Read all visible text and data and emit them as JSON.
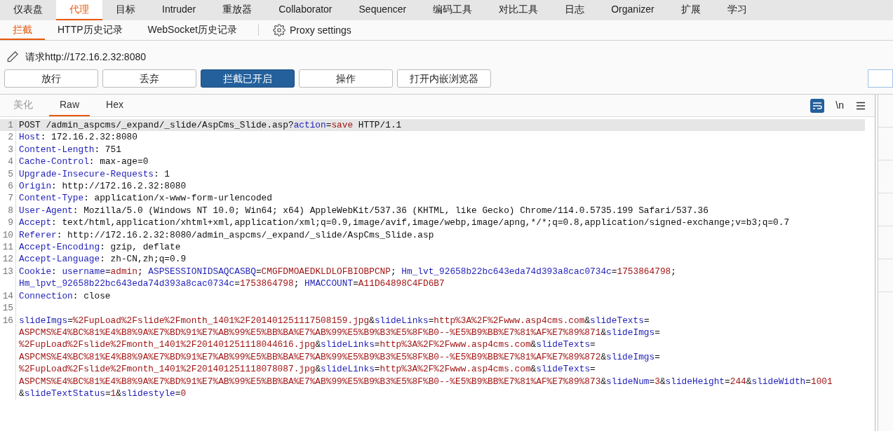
{
  "main_tabs": [
    {
      "label": "仪表盘",
      "selected": false
    },
    {
      "label": "代理",
      "selected": true
    },
    {
      "label": "目标",
      "selected": false
    },
    {
      "label": "Intruder",
      "selected": false
    },
    {
      "label": "重放器",
      "selected": false
    },
    {
      "label": "Collaborator",
      "selected": false
    },
    {
      "label": "Sequencer",
      "selected": false
    },
    {
      "label": "编码工具",
      "selected": false
    },
    {
      "label": "对比工具",
      "selected": false
    },
    {
      "label": "日志",
      "selected": false
    },
    {
      "label": "Organizer",
      "selected": false
    },
    {
      "label": "扩展",
      "selected": false
    },
    {
      "label": "学习",
      "selected": false
    }
  ],
  "sub_tabs": [
    {
      "label": "拦截",
      "selected": true
    },
    {
      "label": "HTTP历史记录",
      "selected": false
    },
    {
      "label": "WebSocket历史记录",
      "selected": false
    }
  ],
  "settings_link": "Proxy settings",
  "request_target": "请求http://172.16.2.32:8080",
  "buttons": [
    {
      "label": "放行",
      "pressed": false
    },
    {
      "label": "丢弃",
      "pressed": false
    },
    {
      "label": "拦截已开启",
      "pressed": true
    },
    {
      "label": "操作",
      "pressed": false
    },
    {
      "label": "打开内嵌浏览器",
      "pressed": false
    }
  ],
  "editor_tabs": [
    {
      "label": "美化",
      "selected": false,
      "disabled": true
    },
    {
      "label": "Raw",
      "selected": true,
      "disabled": false
    },
    {
      "label": "Hex",
      "selected": false,
      "disabled": false
    }
  ],
  "editor_tools": {
    "wrap_on": true,
    "newline_label": "\\n"
  },
  "lines": [
    {
      "number": "1",
      "highlighted": true,
      "rows": [
        {
          "segments": [
            {
              "kind": "plain",
              "text": "POST /admin_aspcms/_expand/_slide/AspCms_Slide.asp?"
            },
            {
              "kind": "name",
              "text": "action"
            },
            {
              "kind": "plain",
              "text": "="
            },
            {
              "kind": "value",
              "text": "save"
            },
            {
              "kind": "plain",
              "text": " HTTP/1.1"
            }
          ]
        }
      ]
    },
    {
      "number": "2",
      "highlighted": false,
      "rows": [
        {
          "segments": [
            {
              "kind": "name",
              "text": "Host"
            },
            {
              "kind": "plain",
              "text": ": 172.16.2.32:8080"
            }
          ]
        }
      ]
    },
    {
      "number": "3",
      "highlighted": false,
      "rows": [
        {
          "segments": [
            {
              "kind": "name",
              "text": "Content-Length"
            },
            {
              "kind": "plain",
              "text": ": 751"
            }
          ]
        }
      ]
    },
    {
      "number": "4",
      "highlighted": false,
      "rows": [
        {
          "segments": [
            {
              "kind": "name",
              "text": "Cache-Control"
            },
            {
              "kind": "plain",
              "text": ": max-age=0"
            }
          ]
        }
      ]
    },
    {
      "number": "5",
      "highlighted": false,
      "rows": [
        {
          "segments": [
            {
              "kind": "name",
              "text": "Upgrade-Insecure-Requests"
            },
            {
              "kind": "plain",
              "text": ": 1"
            }
          ]
        }
      ]
    },
    {
      "number": "6",
      "highlighted": false,
      "rows": [
        {
          "segments": [
            {
              "kind": "name",
              "text": "Origin"
            },
            {
              "kind": "plain",
              "text": ": http://172.16.2.32:8080"
            }
          ]
        }
      ]
    },
    {
      "number": "7",
      "highlighted": false,
      "rows": [
        {
          "segments": [
            {
              "kind": "name",
              "text": "Content-Type"
            },
            {
              "kind": "plain",
              "text": ": application/x-www-form-urlencoded"
            }
          ]
        }
      ]
    },
    {
      "number": "8",
      "highlighted": false,
      "rows": [
        {
          "segments": [
            {
              "kind": "name",
              "text": "User-Agent"
            },
            {
              "kind": "plain",
              "text": ": Mozilla/5.0 (Windows NT 10.0; Win64; x64) AppleWebKit/537.36 (KHTML, like Gecko) Chrome/114.0.5735.199 Safari/537.36"
            }
          ]
        }
      ]
    },
    {
      "number": "9",
      "highlighted": false,
      "rows": [
        {
          "segments": [
            {
              "kind": "name",
              "text": "Accept"
            },
            {
              "kind": "plain",
              "text": ": text/html,application/xhtml+xml,application/xml;q=0.9,image/avif,image/webp,image/apng,*/*;q=0.8,application/signed-exchange;v=b3;q=0.7"
            }
          ]
        }
      ]
    },
    {
      "number": "10",
      "highlighted": false,
      "rows": [
        {
          "segments": [
            {
              "kind": "name",
              "text": "Referer"
            },
            {
              "kind": "plain",
              "text": ": http://172.16.2.32:8080/admin_aspcms/_expand/_slide/AspCms_Slide.asp"
            }
          ]
        }
      ]
    },
    {
      "number": "11",
      "highlighted": false,
      "rows": [
        {
          "segments": [
            {
              "kind": "name",
              "text": "Accept-Encoding"
            },
            {
              "kind": "plain",
              "text": ": gzip, deflate"
            }
          ]
        }
      ]
    },
    {
      "number": "12",
      "highlighted": false,
      "rows": [
        {
          "segments": [
            {
              "kind": "name",
              "text": "Accept-Language"
            },
            {
              "kind": "plain",
              "text": ": zh-CN,zh;q=0.9"
            }
          ]
        }
      ]
    },
    {
      "number": "13",
      "highlighted": false,
      "rows": [
        {
          "segments": [
            {
              "kind": "name",
              "text": "Cookie"
            },
            {
              "kind": "plain",
              "text": ": "
            },
            {
              "kind": "name",
              "text": "username"
            },
            {
              "kind": "plain",
              "text": "="
            },
            {
              "kind": "value",
              "text": "admin"
            },
            {
              "kind": "plain",
              "text": "; "
            },
            {
              "kind": "name",
              "text": "ASPSESSIONIDSAQCASBQ"
            },
            {
              "kind": "plain",
              "text": "="
            },
            {
              "kind": "value",
              "text": "CMGFDMOAEDKLDLOFBIOBPCNP"
            },
            {
              "kind": "plain",
              "text": "; "
            },
            {
              "kind": "name",
              "text": "Hm_lvt_92658b22bc643eda74d393a8cac0734c"
            },
            {
              "kind": "plain",
              "text": "="
            },
            {
              "kind": "value",
              "text": "1753864798"
            },
            {
              "kind": "plain",
              "text": ";"
            }
          ]
        },
        {
          "segments": [
            {
              "kind": "name",
              "text": "Hm_lpvt_92658b22bc643eda74d393a8cac0734c"
            },
            {
              "kind": "plain",
              "text": "="
            },
            {
              "kind": "value",
              "text": "1753864798"
            },
            {
              "kind": "plain",
              "text": "; "
            },
            {
              "kind": "name",
              "text": "HMACCOUNT"
            },
            {
              "kind": "plain",
              "text": "="
            },
            {
              "kind": "value",
              "text": "A11D64898C4FD6B7"
            }
          ]
        }
      ]
    },
    {
      "number": "14",
      "highlighted": false,
      "rows": [
        {
          "segments": [
            {
              "kind": "name",
              "text": "Connection"
            },
            {
              "kind": "plain",
              "text": ": close"
            }
          ]
        }
      ]
    },
    {
      "number": "15",
      "highlighted": false,
      "rows": [
        {
          "segments": []
        }
      ]
    },
    {
      "number": "16",
      "highlighted": false,
      "rows": [
        {
          "segments": [
            {
              "kind": "name",
              "text": "slideImgs"
            },
            {
              "kind": "plain",
              "text": "="
            },
            {
              "kind": "value",
              "text": "%2FupLoad%2Fslide%2Fmonth_1401%2F201401251117508159.jpg"
            },
            {
              "kind": "plain",
              "text": "&"
            },
            {
              "kind": "name",
              "text": "slideLinks"
            },
            {
              "kind": "plain",
              "text": "="
            },
            {
              "kind": "value",
              "text": "http%3A%2F%2Fwww.asp4cms.com"
            },
            {
              "kind": "plain",
              "text": "&"
            },
            {
              "kind": "name",
              "text": "slideTexts"
            },
            {
              "kind": "plain",
              "text": "="
            }
          ]
        },
        {
          "segments": [
            {
              "kind": "value",
              "text": "ASPCMS%E4%BC%81%E4%B8%9A%E7%BD%91%E7%AB%99%E5%BB%BA%E7%AB%99%E5%B9%B3%E5%8F%B0--%E5%B9%BB%E7%81%AF%E7%89%871"
            },
            {
              "kind": "plain",
              "text": "&"
            },
            {
              "kind": "name",
              "text": "slideImgs"
            },
            {
              "kind": "plain",
              "text": "="
            }
          ]
        },
        {
          "segments": [
            {
              "kind": "value",
              "text": "%2FupLoad%2Fslide%2Fmonth_1401%2F201401251118044616.jpg"
            },
            {
              "kind": "plain",
              "text": "&"
            },
            {
              "kind": "name",
              "text": "slideLinks"
            },
            {
              "kind": "plain",
              "text": "="
            },
            {
              "kind": "value",
              "text": "http%3A%2F%2Fwww.asp4cms.com"
            },
            {
              "kind": "plain",
              "text": "&"
            },
            {
              "kind": "name",
              "text": "slideTexts"
            },
            {
              "kind": "plain",
              "text": "="
            }
          ]
        },
        {
          "segments": [
            {
              "kind": "value",
              "text": "ASPCMS%E4%BC%81%E4%B8%9A%E7%BD%91%E7%AB%99%E5%BB%BA%E7%AB%99%E5%B9%B3%E5%8F%B0--%E5%B9%BB%E7%81%AF%E7%89%872"
            },
            {
              "kind": "plain",
              "text": "&"
            },
            {
              "kind": "name",
              "text": "slideImgs"
            },
            {
              "kind": "plain",
              "text": "="
            }
          ]
        },
        {
          "segments": [
            {
              "kind": "value",
              "text": "%2FupLoad%2Fslide%2Fmonth_1401%2F201401251118078087.jpg"
            },
            {
              "kind": "plain",
              "text": "&"
            },
            {
              "kind": "name",
              "text": "slideLinks"
            },
            {
              "kind": "plain",
              "text": "="
            },
            {
              "kind": "value",
              "text": "http%3A%2F%2Fwww.asp4cms.com"
            },
            {
              "kind": "plain",
              "text": "&"
            },
            {
              "kind": "name",
              "text": "slideTexts"
            },
            {
              "kind": "plain",
              "text": "="
            }
          ]
        },
        {
          "segments": [
            {
              "kind": "value",
              "text": "ASPCMS%E4%BC%81%E4%B8%9A%E7%BD%91%E7%AB%99%E5%BB%BA%E7%AB%99%E5%B9%B3%E5%8F%B0--%E5%B9%BB%E7%81%AF%E7%89%873"
            },
            {
              "kind": "plain",
              "text": "&"
            },
            {
              "kind": "name",
              "text": "slideNum"
            },
            {
              "kind": "plain",
              "text": "="
            },
            {
              "kind": "value",
              "text": "3"
            },
            {
              "kind": "plain",
              "text": "&"
            },
            {
              "kind": "name",
              "text": "slideHeight"
            },
            {
              "kind": "plain",
              "text": "="
            },
            {
              "kind": "value",
              "text": "244"
            },
            {
              "kind": "plain",
              "text": "&"
            },
            {
              "kind": "name",
              "text": "slideWidth"
            },
            {
              "kind": "plain",
              "text": "="
            },
            {
              "kind": "value",
              "text": "1001"
            }
          ]
        },
        {
          "segments": [
            {
              "kind": "plain",
              "text": "&"
            },
            {
              "kind": "name",
              "text": "slideTextStatus"
            },
            {
              "kind": "plain",
              "text": "="
            },
            {
              "kind": "value",
              "text": "1"
            },
            {
              "kind": "plain",
              "text": "&"
            },
            {
              "kind": "name",
              "text": "slidestyle"
            },
            {
              "kind": "plain",
              "text": "="
            },
            {
              "kind": "value",
              "text": "0"
            }
          ]
        }
      ]
    }
  ]
}
